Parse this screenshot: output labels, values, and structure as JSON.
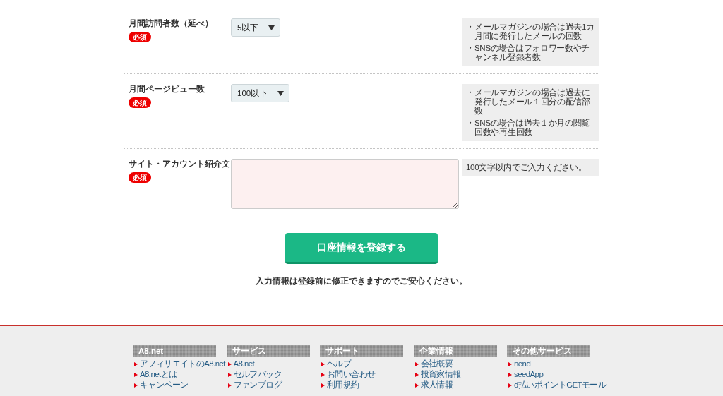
{
  "form": {
    "rows": [
      {
        "label": "月間訪問者数（延べ）",
        "badge": "必須",
        "field": {
          "kind": "select",
          "value": "5以下"
        },
        "notes": [
          {
            "bullet": "・",
            "text": "メールマガジンの場合は過去1カ月間に発行したメールの回数"
          },
          {
            "bullet": "・",
            "text": "SNSの場合はフォロワー数やチャンネル登録者数"
          }
        ]
      },
      {
        "label": "月間ページビュー数",
        "badge": "必須",
        "field": {
          "kind": "select",
          "value": "100以下"
        },
        "notes": [
          {
            "bullet": "・",
            "text": "メールマガジンの場合は過去に発行したメール１回分の配信部数"
          },
          {
            "bullet": "・",
            "text": "SNSの場合は過去１か月の閲覧回数や再生回数"
          }
        ]
      },
      {
        "label": "サイト・アカウント紹介文",
        "badge": "必須",
        "field": {
          "kind": "textarea"
        },
        "notes": [
          {
            "text": "100文字以内でご入力ください。"
          }
        ]
      }
    ],
    "submit_button": "口座情報を登録する",
    "reassurance": "入力情報は登録前に修正できますのでご安心ください。"
  },
  "footer": {
    "columns": [
      {
        "title": "A8.net",
        "links": [
          "アフィリエイトのA8.net",
          "A8.netとは",
          "キャンペーン"
        ]
      },
      {
        "title": "サービス",
        "links": [
          "A8.net",
          "セルフバック",
          "ファンブログ"
        ]
      },
      {
        "title": "サポート",
        "links": [
          "ヘルプ",
          "お問い合わせ",
          "利用規約"
        ]
      },
      {
        "title": "企業情報",
        "links": [
          "会社概要",
          "投資家情報",
          "求人情報"
        ]
      },
      {
        "title": "その他サービス",
        "links": [
          "nend",
          "seedApp",
          "d払いポイントGETモール"
        ]
      }
    ]
  }
}
